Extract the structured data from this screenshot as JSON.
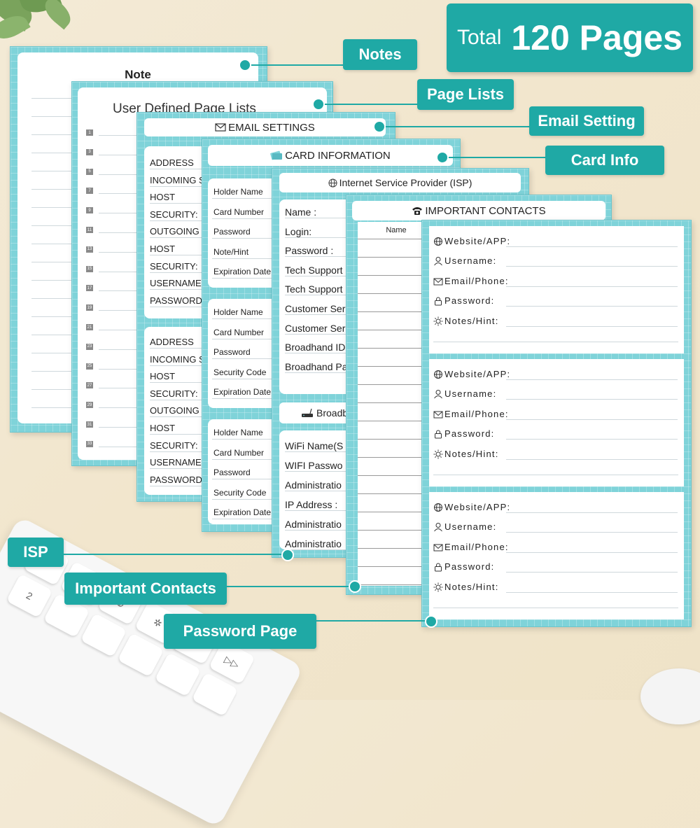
{
  "banner": {
    "total_prefix": "Total",
    "total_value": "120 Pages"
  },
  "callouts": {
    "notes": "Notes",
    "page_lists": "Page Lists",
    "email_setting": "Email Setting",
    "card_info": "Card Info",
    "isp": "ISP",
    "important_contacts": "Important Contacts",
    "password_page": "Password Page"
  },
  "note_page": {
    "title": "Note"
  },
  "page_lists": {
    "title": "User Defined Page Lists",
    "numbers": [
      "1",
      "3",
      "5",
      "7",
      "9",
      "11",
      "13",
      "15",
      "17",
      "19",
      "21",
      "23",
      "25",
      "27",
      "29",
      "31",
      "33"
    ]
  },
  "email_settings": {
    "title": "EMAIL SETTINGS",
    "block1": [
      "ADDRESS",
      "INCOMING S",
      "HOST",
      "SECURITY:",
      "OUTGOING",
      "HOST",
      "SECURITY:",
      "USERNAME",
      "PASSWORD"
    ],
    "block2": [
      "ADDRESS",
      "INCOMING S",
      "HOST",
      "SECURITY:",
      "OUTGOING (",
      "HOST",
      "SECURITY:",
      "USERNAME",
      "PASSWORD"
    ]
  },
  "card_information": {
    "title": "CARD INFORMATION",
    "block1": [
      "Holder Name",
      "Card Number",
      "Password",
      "Note/Hint",
      "Expiration Date"
    ],
    "block2": [
      "Holder Name",
      "Card Number",
      "Password",
      "Security Code",
      "Expiration Date"
    ],
    "block3": [
      "Holder Name",
      "Card Number",
      "Password",
      "Security Code",
      "Expiration Date"
    ]
  },
  "isp": {
    "title": "Internet Service Provider (ISP)",
    "fields": [
      "Name :",
      "Login:",
      "Password :",
      "Tech Support",
      "Tech Support",
      "Customer Ser",
      "Customer Ser",
      "Broadhand ID",
      "Broadhand Pa"
    ],
    "broadband_title": "Broadb",
    "wifi_fields": [
      "WiFi Name(S",
      "WIFI Passwo",
      "Administratio",
      "IP Address :",
      "Administratio",
      "Administratio"
    ]
  },
  "important_contacts": {
    "title": "IMPORTANT CONTACTS",
    "col_name": "Name"
  },
  "password_page": {
    "fields": [
      "Website/APP:",
      "Username:",
      "Email/Phone:",
      "Password:",
      "Notes/Hint:"
    ]
  },
  "colors": {
    "accent": "#1fa9a5",
    "sheet": "#7fd3d9",
    "background": "#f2e6cd"
  }
}
